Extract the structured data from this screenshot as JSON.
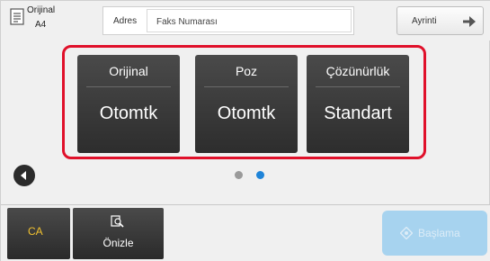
{
  "header": {
    "original_label": "Orijinal",
    "original_size": "A4",
    "address_label": "Adres",
    "fax_placeholder": "Faks Numarası",
    "detail_label": "Ayrinti"
  },
  "tiles": [
    {
      "title": "Orijinal",
      "value": "Otomtk"
    },
    {
      "title": "Poz",
      "value": "Otomtk"
    },
    {
      "title": "Çözünürlük",
      "value": "Standart"
    }
  ],
  "pagination": {
    "current_page": 2,
    "total_pages": 2
  },
  "footer": {
    "ca_label": "CA",
    "preview_label": "Önizle",
    "start_label": "Başlama"
  },
  "colors": {
    "selection_frame": "#e0102a",
    "tile_bg": "#3a3a3a",
    "active_dot": "#1f84d8",
    "ca_text": "#f2c230",
    "start_bg": "#a7d3ef"
  },
  "icons": {
    "original": "document-icon",
    "detail": "arrow-right-icon",
    "prev": "chevron-left-icon",
    "preview": "preview-magnifier-icon",
    "start": "start-diamond-icon"
  }
}
